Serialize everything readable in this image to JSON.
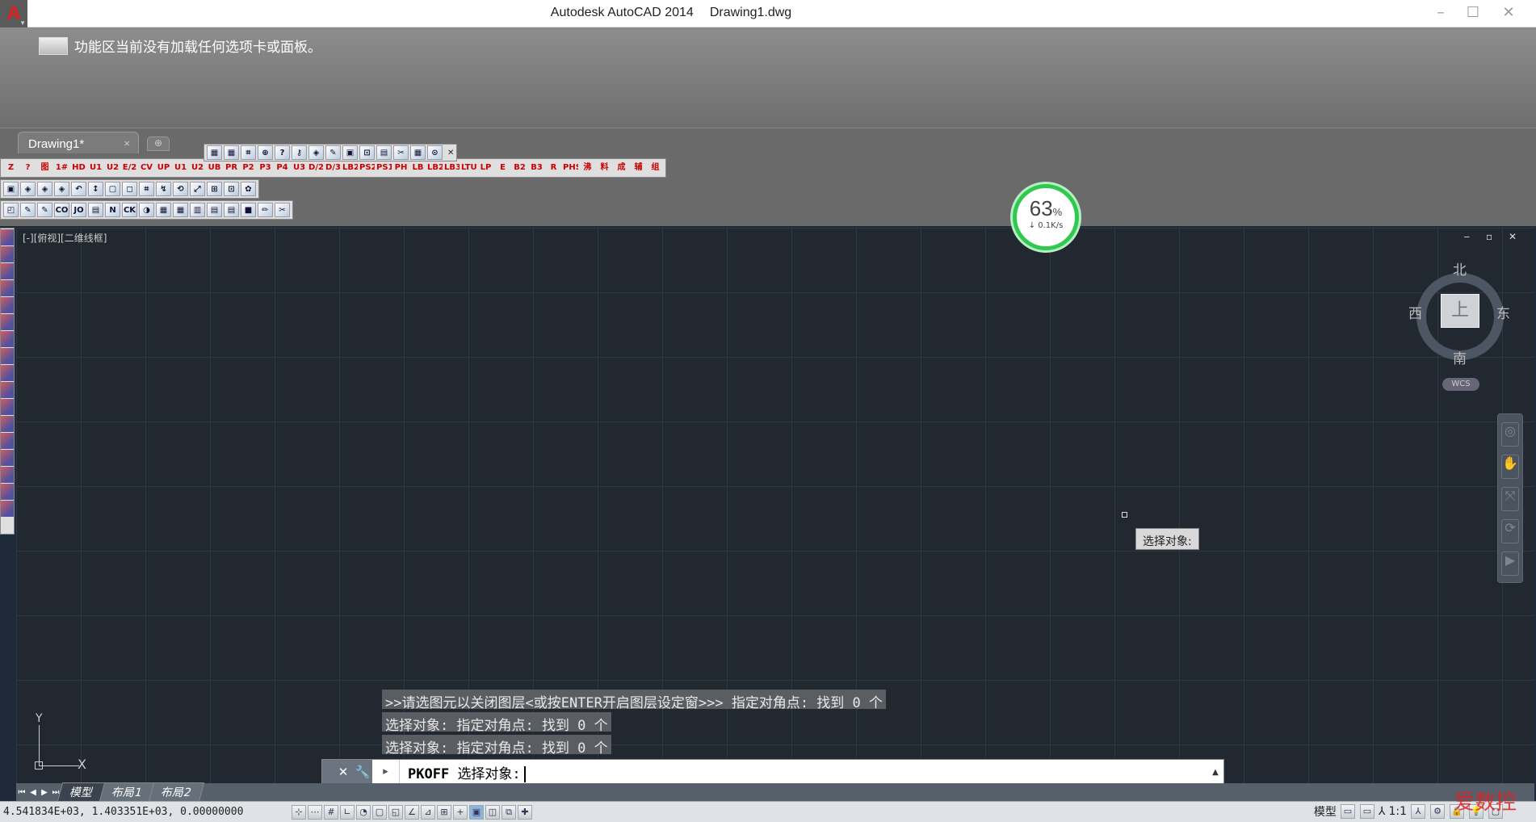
{
  "window": {
    "app_name": "Autodesk AutoCAD 2014",
    "file_name": "Drawing1.dwg",
    "app_logo": "A",
    "minimize_icon": "minimize-icon",
    "maximize_icon": "maximize-icon",
    "close_icon": "close-icon"
  },
  "ribbon": {
    "message": "功能区当前没有加载任何选项卡或面板。"
  },
  "tabs": {
    "doc_tab": "Drawing1*",
    "doc_tab_close": "×"
  },
  "toolbars": {
    "row1": [
      "Z",
      "?",
      "图",
      "1#",
      "HD",
      "U1",
      "U2",
      "E/2",
      "CV",
      "UP",
      "U1",
      "U2",
      "UB",
      "PR",
      "P2",
      "P3",
      "P4",
      "U3",
      "D/2",
      "D/3",
      "LB2",
      "PS2",
      "PS1",
      "PH",
      "LB",
      "LB2",
      "LB3",
      "LTU",
      "LP",
      "E",
      "B2",
      "B3",
      "R",
      "PHS",
      "沸",
      "料",
      "成",
      "辅",
      "组"
    ],
    "row2": [
      "▣",
      "◈",
      "◈",
      "◈",
      "↶",
      "↕",
      "▢",
      "◻",
      "⌗",
      "↯",
      "⟲",
      "⤢",
      "⊞",
      "⊡",
      "✿"
    ],
    "row3": [
      "◰",
      "✎",
      "✎",
      "CO",
      "JO",
      "▤",
      "N",
      "CK",
      "◑",
      "▦",
      "▦",
      "▥",
      "▤",
      "▤",
      "■",
      "✏",
      "✂"
    ],
    "float": [
      "▦",
      "▦",
      "⌗",
      "⊕",
      "?",
      "⚷",
      "◈",
      "✎",
      "▣",
      "⊡",
      "▤",
      "✂",
      "▦",
      "⊙"
    ]
  },
  "netmon": {
    "percent": "63",
    "percent_unit": "%",
    "speed": "↓ 0.1K/s"
  },
  "viewport": {
    "label": "[-][俯视][二维线框]",
    "controls": "‒ ▫ ✕"
  },
  "viewcube": {
    "north": "北",
    "south": "南",
    "east": "东",
    "west": "西",
    "face": "上",
    "wcs": "WCS"
  },
  "tooltip": "选择对象:",
  "ucs": {
    "y": "Y",
    "x": "X"
  },
  "history": [
    ">>请选图元以关闭图层<或按ENTER开启图层设定窗>>> 指定对角点: 找到 0 个",
    "选择对象: 指定对角点: 找到 0 个",
    "选择对象: 指定对角点: 找到 0 个"
  ],
  "command": {
    "name": "PKOFF",
    "prompt": "选择对象:",
    "close": "✕",
    "customize": "🔧",
    "prompt_icon": "▸"
  },
  "layouts": [
    "模型",
    "布局1",
    "布局2"
  ],
  "status": {
    "coords": "4.541834E+03, 1.403351E+03, 0.00000000",
    "model_label": "模型",
    "scale": "1:1"
  },
  "watermark": "爱数控"
}
